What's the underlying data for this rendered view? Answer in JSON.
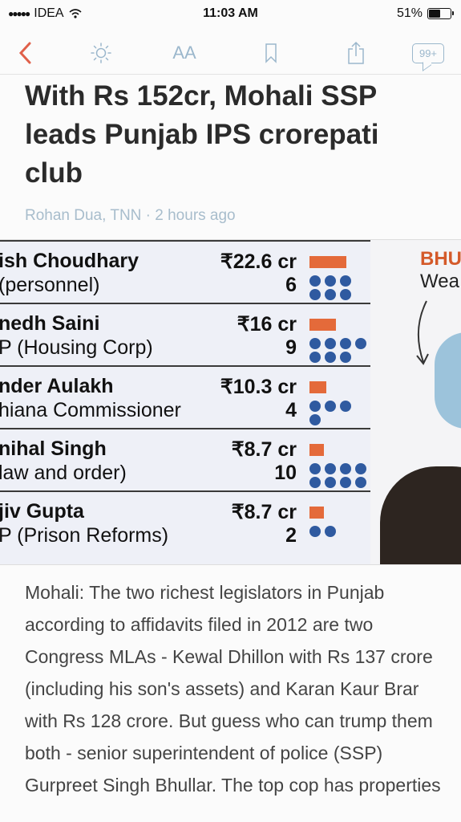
{
  "status_bar": {
    "carrier": "IDEA",
    "time": "11:03 AM",
    "battery": "51%"
  },
  "toolbar": {
    "font_label": "AA",
    "comments_count": "99+"
  },
  "article": {
    "headline": "With Rs 152cr, Mohali SSP leads Punjab IPS crorepati club",
    "byline": "Rohan Dua, TNN · 2 hours ago",
    "body": "Mohali: The two richest legislators in Punjab according to affidavits filed in 2012 are two Congress MLAs - Kewal Dhillon with Rs 137 crore (including his son's assets) and Karan Kaur Brar with Rs 128 crore. But guess who can trump them both - senior superintendent of police (SSP) Gurpreet Singh Bhullar. The top cop has properties"
  },
  "infographic": {
    "rows": [
      {
        "name": "ish Choudhary",
        "role": " (personnel)",
        "amount": "₹22.6 cr",
        "count": "6",
        "wealth_cr": 22.6,
        "dots": 6
      },
      {
        "name": "nedh Saini",
        "role": "P (Housing Corp)",
        "amount": "₹16 cr",
        "count": "9",
        "wealth_cr": 16,
        "dots": 9
      },
      {
        "name": "nder Aulakh",
        "role": "hiana Commissioner",
        "amount": "₹10.3 cr",
        "count": "4",
        "wealth_cr": 10.3,
        "dots": 4
      },
      {
        "name": "nihal Singh",
        "role": "law and order)",
        "amount": "₹8.7 cr",
        "count": "10",
        "wealth_cr": 8.7,
        "dots": 10
      },
      {
        "name": "jiv Gupta",
        "role": "P (Prison Reforms)",
        "amount": "₹8.7 cr",
        "count": "2",
        "wealth_cr": 8.7,
        "dots": 2
      }
    ],
    "side_title": "BHU",
    "side_text": "Wea",
    "colors": {
      "bar": "#e46a3a",
      "dot": "#2f5aa0",
      "accent": "#d45a2a"
    }
  }
}
